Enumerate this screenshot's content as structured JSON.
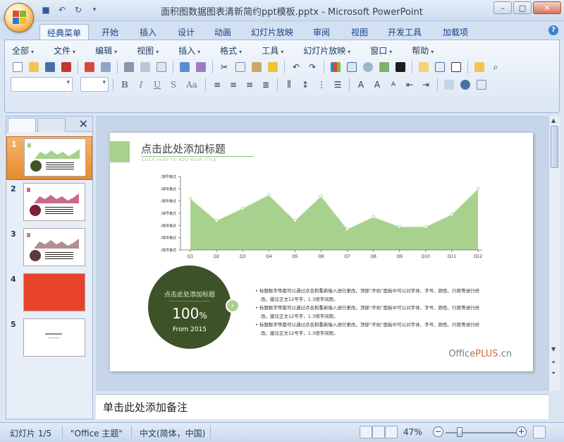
{
  "window": {
    "title": "面积图数据图表清新简约ppt模板.pptx - Microsoft PowerPoint",
    "controls": [
      "–",
      "□",
      "✕"
    ]
  },
  "tabs": [
    "经典菜单",
    "开始",
    "插入",
    "设计",
    "动画",
    "幻灯片放映",
    "审阅",
    "视图",
    "开发工具",
    "加载项"
  ],
  "menu": [
    "全部",
    "文件",
    "编辑",
    "视图",
    "插入",
    "格式",
    "工具",
    "幻灯片放映",
    "窗口",
    "帮助"
  ],
  "format_buttons": [
    "B",
    "I",
    "U",
    "S",
    "Aa"
  ],
  "thumbnails": [
    {
      "num": "1",
      "accent": "#a8d18d",
      "circle": "#3e5228"
    },
    {
      "num": "2",
      "accent": "#c96a86",
      "circle": "#7a1f3c"
    },
    {
      "num": "3",
      "accent": "#b09090",
      "circle": "#5a3a3a"
    },
    {
      "num": "4",
      "accent": "#e8432a",
      "circle": "#e8432a"
    },
    {
      "num": "5",
      "accent": "#ffffff",
      "circle": "#ffffff"
    }
  ],
  "slide": {
    "title": "点击此处添加标题",
    "subtitle": "CLICK HERE TO ADD YOUR TITLE",
    "circle_title": "点击此处添加标题",
    "big_value": "100",
    "big_unit": "%",
    "from": "From 2015",
    "bullets": [
      "标题数字等都可以通过点击和重新输入进行更改，顶部“开始”面板中可以对字体、字号、颜色、行距等进行修改。建议正文12号字，1.3倍字间距。",
      "标题数字等都可以通过点击和重新输入进行更改，顶部“开始”面板中可以对字体、字号、颜色、行距等进行修改。建议正文12号字，1.3倍字间距。",
      "标题数字等都可以通过点击和重新输入进行更改，顶部“开始”面板中可以对字体、字号、颜色、行距等进行修改。建议正文12号字，1.3倍字间距。"
    ],
    "brand_prefix": "Office",
    "brand_mid": "PLUS",
    "brand_suffix": ".cn"
  },
  "chart_data": {
    "type": "area",
    "categories": [
      "Q1",
      "Q2",
      "Q3",
      "Q4",
      "Q5",
      "Q6",
      "Q7",
      "Q8",
      "Q9",
      "Q10",
      "Q11",
      "Q12"
    ],
    "series": [
      {
        "values": [
          4.2,
          2.4,
          3.4,
          4.5,
          2.4,
          4.4,
          1.7,
          2.7,
          1.9,
          1.9,
          2.9,
          5.0
        ]
      }
    ],
    "ylim": [
      0,
      6
    ],
    "ytick_labels": [
      "/填号格式",
      "/填号格式",
      "/填号格式",
      "/填号格式",
      "/填号格式",
      "/填号格式",
      "/填号格式"
    ],
    "color": "#a8d18d",
    "marker_color": "#ffffff",
    "grid": false
  },
  "notes": {
    "placeholder": "单击此处添加备注"
  },
  "status": {
    "slide": "幻灯片 1/5",
    "theme": "\"Office 主题\"",
    "lang": "中文(简体，中国)",
    "zoom": "47%"
  }
}
